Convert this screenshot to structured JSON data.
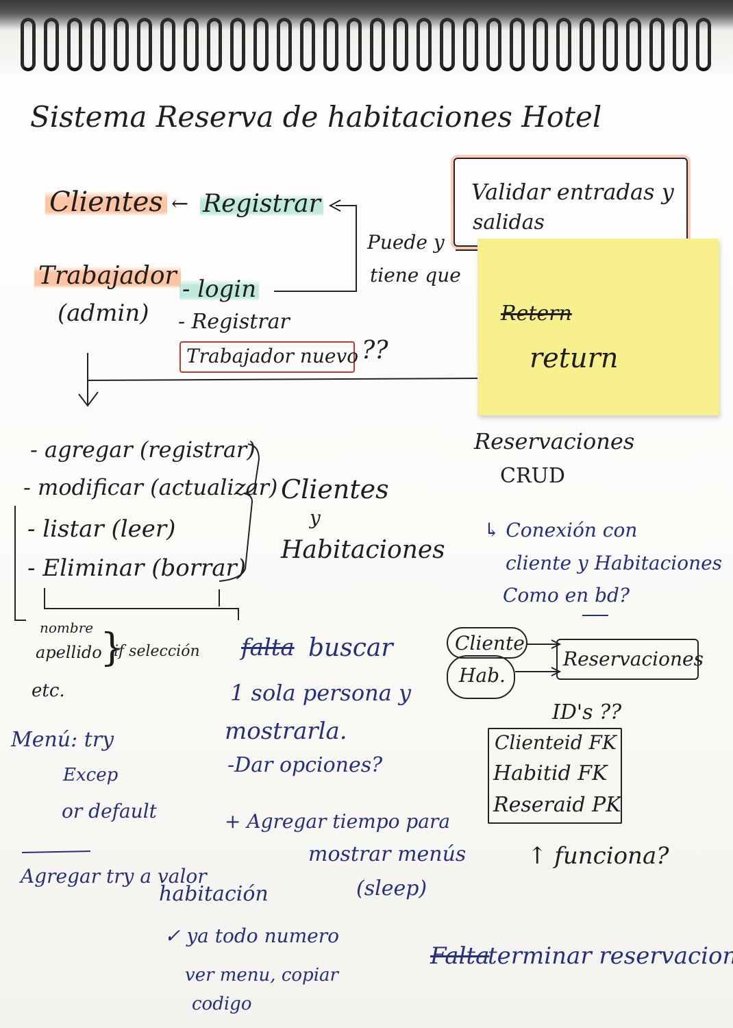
{
  "title": "Sistema Reserva de habitaciones Hotel",
  "top_left": {
    "clientes": "Clientes",
    "arrow_left": "←",
    "registrar": "Registrar",
    "trabajador": "Trabajador",
    "admin": "(admin)",
    "login": "- login",
    "registrar2": "- Registrar",
    "trabajador_nuevo": "Trabajador nuevo",
    "qq": "??",
    "puede": "Puede y",
    "tiene": "tiene que"
  },
  "validar": {
    "line1": "Validar entradas y",
    "line2": "salidas"
  },
  "sticky": {
    "struck": "Retern",
    "word": "return"
  },
  "crud_list": {
    "items": [
      "- agregar (registrar)",
      "- modificar (actualizar)",
      "- listar (leer)",
      "- Eliminar (borrar)"
    ],
    "clientes": "Clientes",
    "y": "y",
    "habitaciones": "Habitaciones"
  },
  "sub_fields": {
    "nombre": "nombre",
    "apellido": "apellido",
    "brace": "}",
    "if": "if selección",
    "etc": "etc."
  },
  "buscar": {
    "falta": "falta",
    "buscar": "buscar",
    "l2": "1 sola persona y",
    "l3": "mostrarla.",
    "l4": "-Dar opciones?"
  },
  "menu": {
    "l1": "Menú: try",
    "l2": "Excep",
    "l3": "or default"
  },
  "agregar_tiempo": {
    "l1": "+ Agregar tiempo para",
    "l2": "mostrar menús",
    "l3": "(sleep)"
  },
  "agregar_try": {
    "l1": "Agregar try a valor",
    "l2": "habitación",
    "l3": "✓ ya todo numero",
    "l4": "ver menu, copiar",
    "l5": "codigo"
  },
  "reservaciones": {
    "title": "Reservaciones",
    "crud": "CRUD",
    "conexion1": "↳ Conexión con",
    "conexion2": "cliente y Habitaciones",
    "conexion3": "Como en bd?",
    "cliente_box": "Cliente",
    "hab_box": "Hab.",
    "res_box": "Reservaciones",
    "ids": "ID's ??",
    "table": [
      "Clienteid FK",
      "Habitid FK",
      "Reseraid PK"
    ],
    "funciona": "↑ funciona?",
    "falta": "Falta",
    "terminar": "terminar reservaciones"
  }
}
